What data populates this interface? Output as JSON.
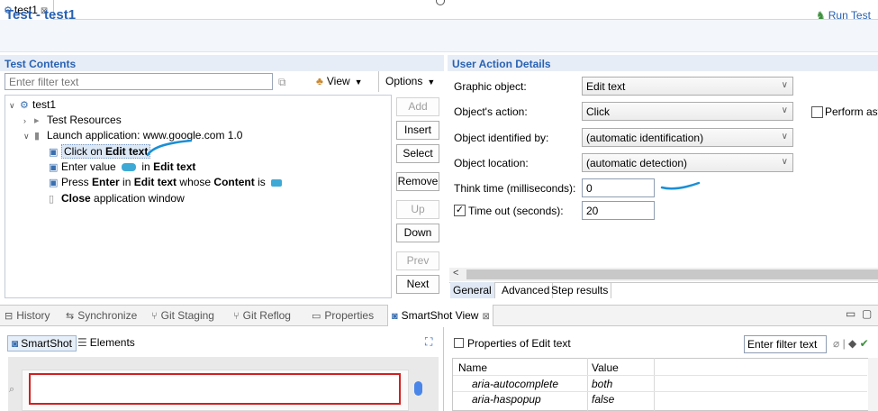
{
  "editor_tab": {
    "label": "test1",
    "close": "⊠"
  },
  "header": {
    "title": "Test - test1",
    "run_label": "Run Test"
  },
  "left_panel": {
    "section_title": "Test Contents",
    "filter_placeholder": "Enter filter text",
    "view_label": "View",
    "options_label": "Options",
    "tree": [
      {
        "label": "test1"
      },
      {
        "label": "Test Resources"
      },
      {
        "label": "Launch application: www.google.com  1.0"
      },
      {
        "pre": "Click on ",
        "bold": "Edit text"
      },
      {
        "pre": "Enter value ",
        "mid": " in ",
        "bold": "Edit text"
      },
      {
        "pre": "Press ",
        "bold1": "Enter",
        "mid": " in ",
        "bold2": "Edit text",
        "mid2": " whose ",
        "bold3": "Content",
        "post": " is "
      },
      {
        "bold": "Close",
        "post": " application window"
      }
    ],
    "buttons": {
      "add": "Add",
      "insert": "Insert",
      "select": "Select",
      "remove": "Remove",
      "up": "Up",
      "down": "Down",
      "prev": "Prev",
      "next": "Next"
    }
  },
  "right_panel": {
    "section_title": "User Action Details",
    "graphic_object_label": "Graphic object:",
    "graphic_object_value": "Edit text",
    "action_label": "Object's action:",
    "action_value": "Click",
    "perform_label": "Perform asy",
    "identified_label": "Object identified by:",
    "identified_value": "(automatic identification)",
    "location_label": "Object location:",
    "location_value": "(automatic detection)",
    "think_label": "Think time (milliseconds):",
    "think_value": "0",
    "timeout_label": "Time out (seconds):",
    "timeout_value": "20",
    "timeout_checked": true,
    "tabs": [
      "General",
      "Advanced",
      "Step results"
    ]
  },
  "bottom_tabs": [
    "History",
    "Synchronize",
    "Git Staging",
    "Git Reflog",
    "Properties",
    "SmartShot View"
  ],
  "smartshot": {
    "smartshot_label": "SmartShot",
    "elements_label": "Elements"
  },
  "properties": {
    "title": "Properties of Edit text",
    "filter_placeholder": "Enter filter text",
    "columns": [
      "Name",
      "Value"
    ],
    "rows": [
      {
        "name": "aria-autocomplete",
        "value": "both"
      },
      {
        "name": "aria-haspopup",
        "value": "false"
      }
    ]
  },
  "colors": {
    "accent": "#2a62b3",
    "highlight": "#d21f1f",
    "annotation": "#1a8fd6"
  }
}
